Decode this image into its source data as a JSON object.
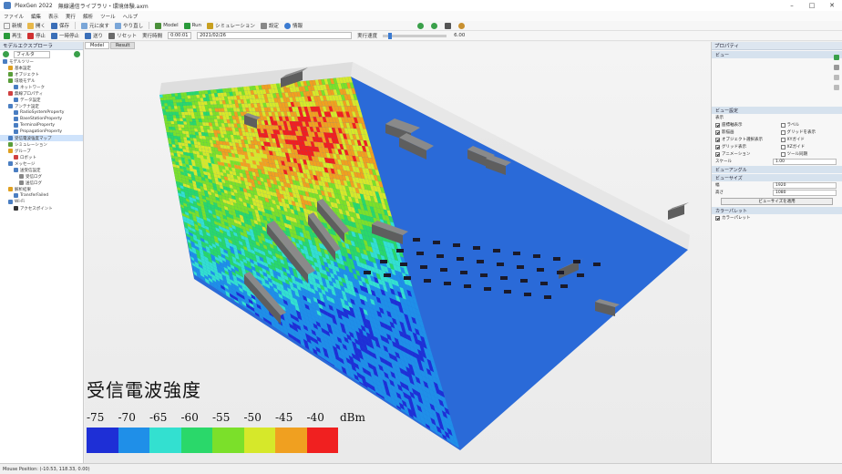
{
  "titlebar": {
    "app_name": "PlexGen 2022",
    "document": "無線通信ライブラリ・環境体験.axm"
  },
  "menu": [
    "ファイル",
    "編集",
    "表示",
    "実行",
    "解析",
    "ツール",
    "ヘルプ"
  ],
  "toolbar1": {
    "buttons": [
      "新規",
      "開く",
      "保存",
      "元に戻す",
      "やり直し",
      "Model",
      "Run",
      "シミュレーション",
      "設定",
      "情報"
    ]
  },
  "toolbar2": {
    "buttons": [
      "再生",
      "停止",
      "一時停止",
      "送り",
      "リセット"
    ],
    "time_label": "実行時間",
    "time_value": "0:00:01",
    "date_value": "2021/02/26",
    "speed_label": "実行速度",
    "speed_value": "6.00"
  },
  "left_panel": {
    "title": "モデルエクスプローラ",
    "filter_placeholder": "フィルタ",
    "tree": [
      {
        "label": "モデルツリー",
        "level": 0,
        "color": "#4a7ec2"
      },
      {
        "label": "基本設定",
        "level": 1,
        "color": "#e0a020"
      },
      {
        "label": "オブジェクト",
        "level": 1,
        "color": "#5a9e3a"
      },
      {
        "label": "環境モデル",
        "level": 1,
        "color": "#5a9e3a"
      },
      {
        "label": "ネットワーク",
        "level": 2,
        "color": "#4a7ec2"
      },
      {
        "label": "無線プロパティ",
        "level": 1,
        "color": "#d04040"
      },
      {
        "label": "データ設定",
        "level": 2,
        "color": "#4a7ec2"
      },
      {
        "label": "アンテナ設定",
        "level": 1,
        "color": "#4a7ec2"
      },
      {
        "label": "RadioSystemProperty",
        "level": 2,
        "color": "#4a7ec2"
      },
      {
        "label": "BaseStationProperty",
        "level": 2,
        "color": "#4a7ec2"
      },
      {
        "label": "TerminalProperty",
        "level": 2,
        "color": "#4a7ec2"
      },
      {
        "label": "PropagationProperty",
        "level": 2,
        "color": "#4a7ec2"
      },
      {
        "label": "受信電波強度マップ",
        "level": 1,
        "color": "#4a7ec2",
        "selected": true
      },
      {
        "label": "シミュレーション",
        "level": 1,
        "color": "#5a9e3a"
      },
      {
        "label": "グループ",
        "level": 1,
        "color": "#e0a020"
      },
      {
        "label": "ロボット",
        "level": 2,
        "color": "#d04040"
      },
      {
        "label": "メッセージ",
        "level": 1,
        "color": "#4a7ec2"
      },
      {
        "label": "送受信設定",
        "level": 2,
        "color": "#4a7ec2"
      },
      {
        "label": "受信ログ",
        "level": 3,
        "color": "#888888"
      },
      {
        "label": "送信ログ",
        "level": 3,
        "color": "#888888"
      },
      {
        "label": "解析結果",
        "level": 1,
        "color": "#e0a020"
      },
      {
        "label": "TransferFailed",
        "level": 2,
        "color": "#4a7ec2"
      },
      {
        "label": "Wi-Fi",
        "level": 1,
        "color": "#4a7ec2"
      },
      {
        "label": "アクセスポイント",
        "level": 2,
        "color": "#333333"
      }
    ]
  },
  "viewport": {
    "tabs": [
      "Model",
      "Result"
    ]
  },
  "right_panel": {
    "title": "プロパティ",
    "section_view": "ビュー",
    "section_display": "ビュー設定",
    "section_display_sub": "表示",
    "checkboxes": [
      {
        "label": "座標軸表示",
        "checked": true
      },
      {
        "label": "ラベル",
        "checked": false
      },
      {
        "label": "影描画",
        "checked": true
      },
      {
        "label": "グリッドを表示",
        "checked": false
      },
      {
        "label": "オブジェクト選択表示",
        "checked": true
      },
      {
        "label": "XYガイド",
        "checked": false
      },
      {
        "label": "グリッド表示",
        "checked": true
      },
      {
        "label": "XZガイド",
        "checked": false
      },
      {
        "label": "アニメーション",
        "checked": true
      },
      {
        "label": "ツール同期",
        "checked": false
      }
    ],
    "scale_label": "スケール",
    "scale_value": "1.00",
    "section_camera": "ビューアングル",
    "section_size": "ビューサイズ",
    "width_label": "幅",
    "width_value": "1920",
    "height_label": "高さ",
    "height_value": "1080",
    "apply_button": "ビューサイズを適用",
    "section_color": "カラーパレット",
    "palette_item": "カラーパレット"
  },
  "legend": {
    "title": "受信電波強度",
    "ticks": [
      "-75",
      "-70",
      "-65",
      "-60",
      "-55",
      "-50",
      "-45",
      "-40"
    ],
    "unit": "dBm",
    "colors": [
      "#1e2fd6",
      "#1f8fe8",
      "#33e0d0",
      "#2ad86a",
      "#7be02a",
      "#d6e82a",
      "#f0a020",
      "#f02020"
    ]
  },
  "statusbar": {
    "text": "Mouse Position: (-10.53, 118.33, 0.00)"
  }
}
